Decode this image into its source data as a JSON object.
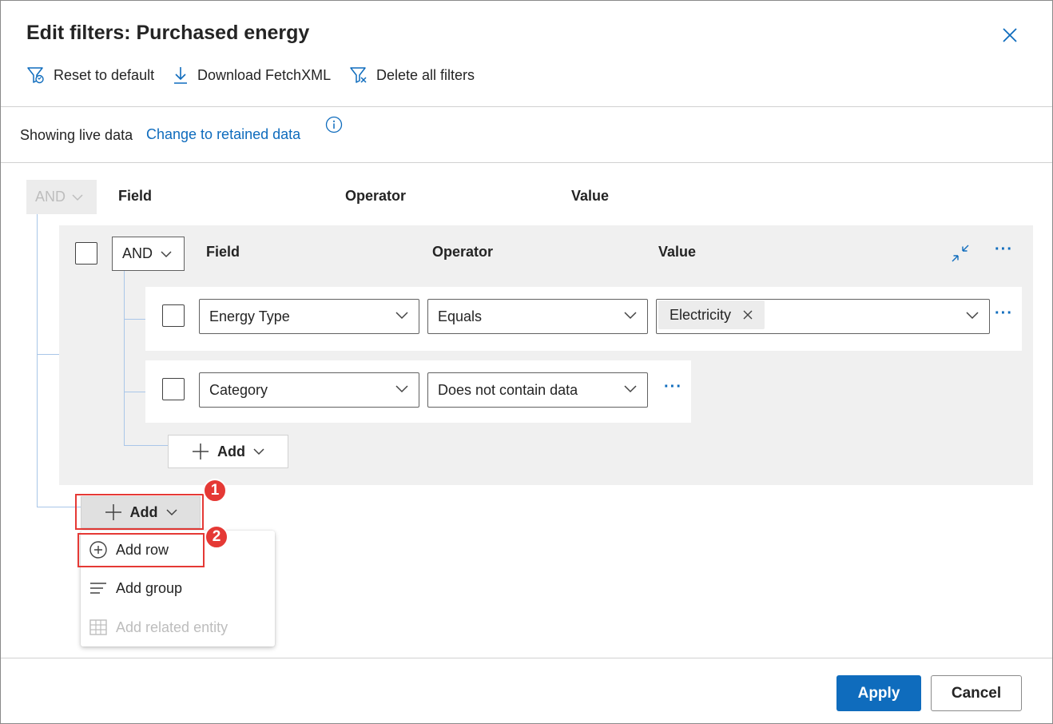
{
  "dialog": {
    "title": "Edit filters: Purchased energy",
    "close_icon": "close-icon"
  },
  "toolbar": {
    "reset_label": "Reset to default",
    "download_label": "Download FetchXML",
    "delete_label": "Delete all filters"
  },
  "data_source": {
    "status_text": "Showing live data",
    "change_link": "Change to retained data"
  },
  "outer_group": {
    "operator": "AND",
    "headers": {
      "field": "Field",
      "operator": "Operator",
      "value": "Value"
    }
  },
  "inner_group": {
    "operator": "AND",
    "headers": {
      "field": "Field",
      "operator": "Operator",
      "value": "Value"
    },
    "rows": [
      {
        "field": "Energy Type",
        "operator": "Equals",
        "value_tag": "Electricity"
      },
      {
        "field": "Category",
        "operator": "Does not contain data"
      }
    ],
    "add_label": "Add"
  },
  "outer_add": {
    "label": "Add"
  },
  "add_menu": {
    "items": [
      {
        "label": "Add row",
        "icon": "add-circle-icon",
        "enabled": true
      },
      {
        "label": "Add group",
        "icon": "group-lines-icon",
        "enabled": true
      },
      {
        "label": "Add related entity",
        "icon": "related-entity-icon",
        "enabled": false
      }
    ]
  },
  "callouts": [
    "1",
    "2"
  ],
  "footer": {
    "apply_label": "Apply",
    "cancel_label": "Cancel"
  },
  "colors": {
    "accent": "#0f6cbd",
    "callout": "#e53935",
    "group_bg": "#f0f0f0"
  }
}
